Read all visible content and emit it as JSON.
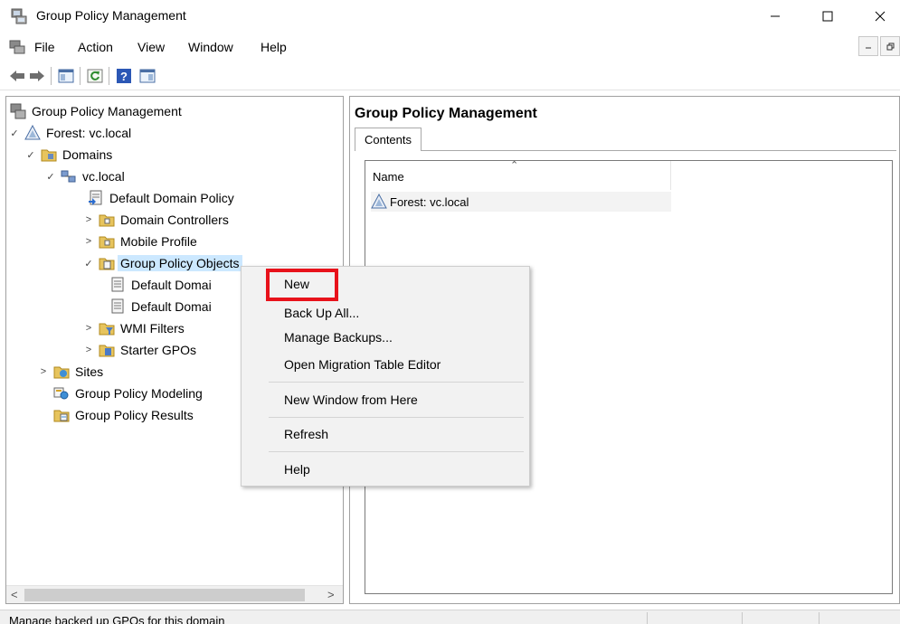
{
  "window": {
    "title": "Group Policy Management"
  },
  "menu": [
    "File",
    "Action",
    "View",
    "Window",
    "Help"
  ],
  "tree": {
    "root": "Group Policy Management",
    "forest": "Forest: vc.local",
    "domains": "Domains",
    "domain": "vc.local",
    "default_domain_policy": "Default Domain Policy",
    "domain_controllers": "Domain Controllers",
    "mobile_profile": "Mobile Profile",
    "gpo": "Group Policy Objects",
    "gpo_child_1": "Default Domai",
    "gpo_child_2": "Default Domai",
    "wmi_filters": "WMI Filters",
    "starter_gpos": "Starter GPOs",
    "sites": "Sites",
    "modeling": "Group Policy Modeling",
    "results": "Group Policy Results"
  },
  "right_pane": {
    "title": "Group Policy Management",
    "tab": "Contents",
    "column_name": "Name",
    "row": "Forest: vc.local"
  },
  "context_menu": {
    "new": "New",
    "back_up_all": "Back Up All...",
    "manage_backups": "Manage Backups...",
    "open_migration": "Open Migration Table Editor",
    "new_window": "New Window from Here",
    "refresh": "Refresh",
    "help": "Help"
  },
  "status": "Manage backed up GPOs for this domain",
  "colors": {
    "highlight": "#e8121b",
    "selection": "#cce8ff"
  }
}
